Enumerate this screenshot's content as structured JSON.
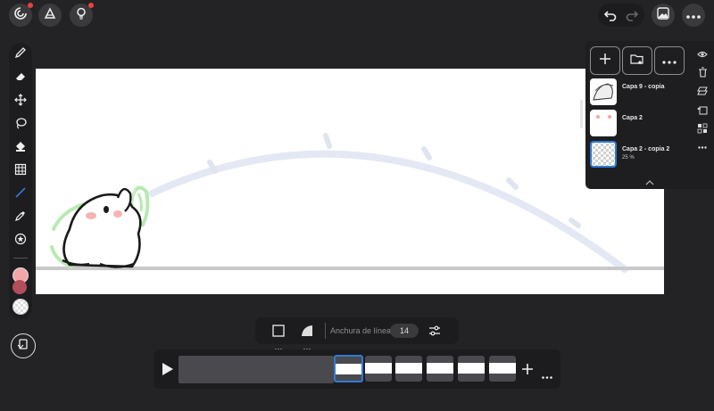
{
  "top_left": {
    "icons": [
      "gallery-icon",
      "symmetry-icon",
      "idea-icon"
    ]
  },
  "top_right": {
    "icons": [
      "undo-icon",
      "redo-icon",
      "image-icon",
      "more-icon"
    ]
  },
  "tools": [
    "pen-icon",
    "eraser-icon",
    "move-icon",
    "lasso-icon",
    "fill-icon",
    "grid-icon",
    "line-icon",
    "eyedropper-icon",
    "stamp-icon"
  ],
  "colors": {
    "primary": "#f2a6a8",
    "secondary": "#b14e5c",
    "accent": "#2f7ad8"
  },
  "layers": [
    {
      "name": "Capa 9 - copia",
      "opacity": ""
    },
    {
      "name": "Capa 2",
      "opacity": ""
    },
    {
      "name": "Capa 2 - copia 2",
      "opacity": "25 %"
    }
  ],
  "line_options": {
    "label": "Anchura de línea",
    "value": "14"
  },
  "timeline": {
    "frames": 6,
    "selected_frame": 1
  }
}
